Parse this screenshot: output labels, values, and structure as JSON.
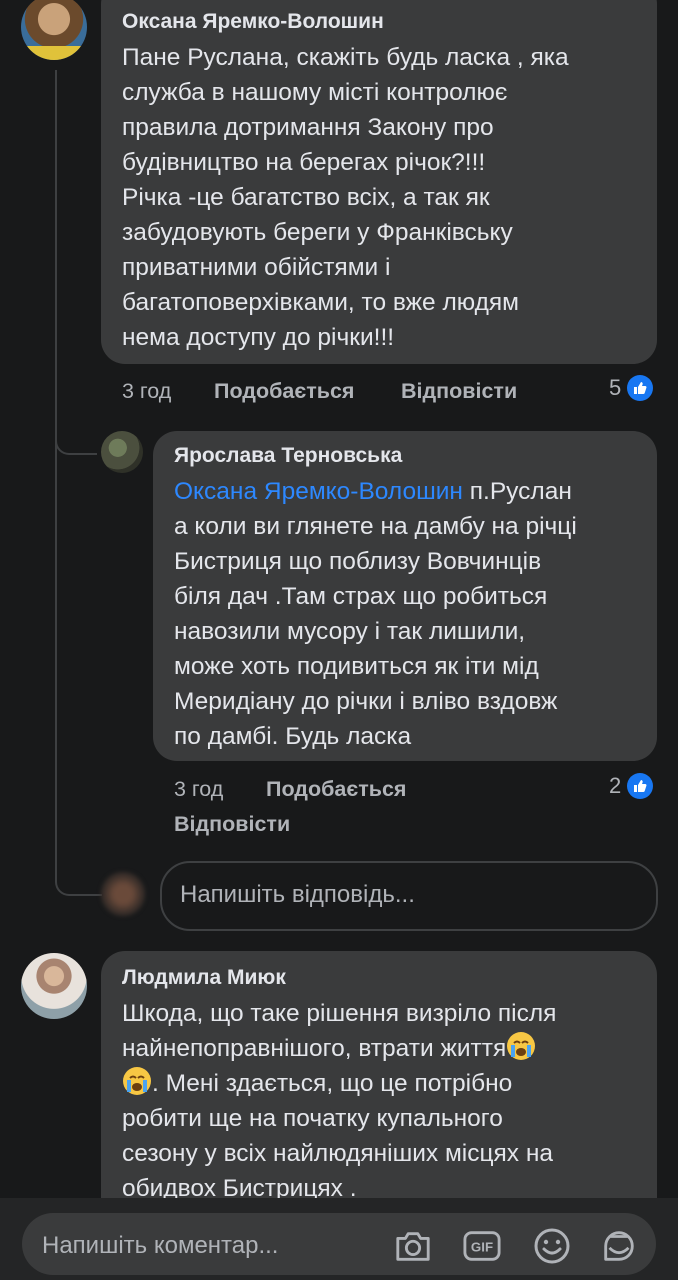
{
  "comments": [
    {
      "author": "Оксана Яремко-Волошин",
      "lines": [
        "Пане Руслана, скажіть будь ласка , яка",
        "служба в нашому місті контролює",
        "правила дотримання Закону про",
        "будівництво на берегах річок?!!!",
        "Річка -це багатство всіх, а так як",
        "забудовують береги у Франківську",
        "приватними обійстями і",
        "багатоповерхівками, то вже людям",
        "нема доступу до річки!!!"
      ],
      "time": "3 год",
      "like_label": "Подобається",
      "reply_label": "Відповісти",
      "reactions": "5"
    },
    {
      "author": "Ярослава Терновська",
      "mention": "Оксана Яремко-Волошин",
      "first_line_rest": " п.Руслан",
      "lines": [
        "а коли ви глянете на дамбу на річці",
        "Бистриця що поблизу Вовчинців",
        "біля дач .Там страх що робиться",
        "навозили мусору і так лишили,",
        "може хоть подивиться  як іти мід",
        "Меридіану до річки і вліво вздовж",
        "по дамбі. Будь ласка"
      ],
      "time": "3 год",
      "like_label": "Подобається",
      "reply_label": "Відповісти",
      "reactions": "2"
    },
    {
      "author": "Людмила Миюк",
      "line1": "Шкода, що таке рішення визріло після",
      "line2": "найнепоправнішого, втрати життя",
      "line3": ". Мені здається, що це потрібно",
      "lines": [
        "робити ще на початку купального",
        "сезону у всіх найлюдяніших місцях на",
        "обидвох Бистрицях ."
      ]
    }
  ],
  "reply_input": {
    "placeholder": "Напишіть відповідь..."
  },
  "composer": {
    "placeholder": "Напишіть коментар..."
  },
  "icons": {
    "camera": "camera-icon",
    "gif": "GIF",
    "emoji": "smiley-icon",
    "sticker": "sticker-icon"
  },
  "colors": {
    "background": "#18191a",
    "bubble": "#3a3b3c",
    "mention": "#2d88ff",
    "like": "#1877f2"
  }
}
